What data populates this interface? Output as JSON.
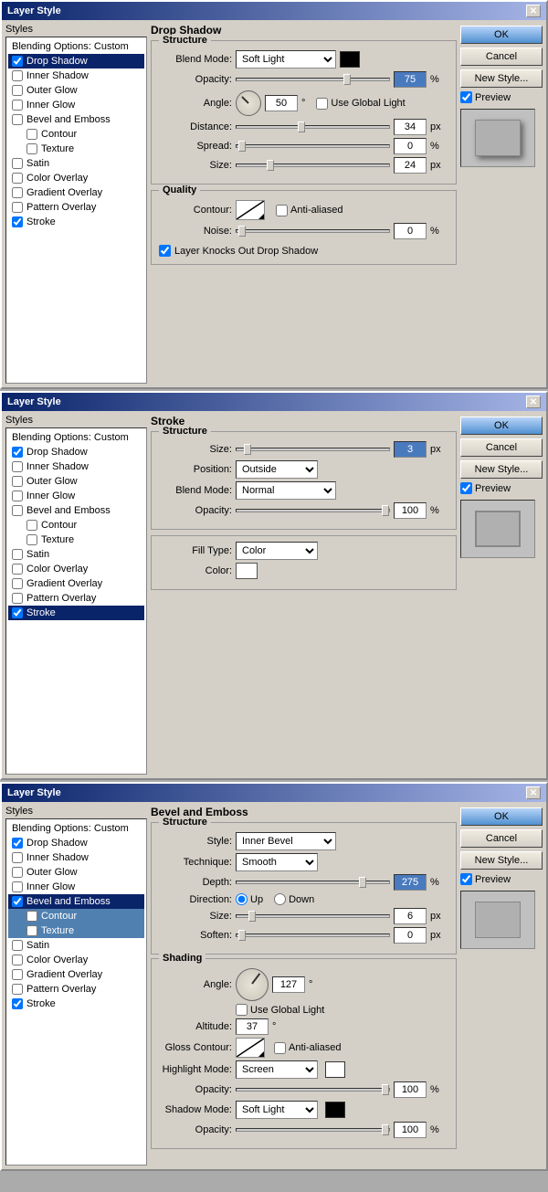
{
  "dialog1": {
    "title": "Layer Style",
    "section": "Drop Shadow",
    "structure_label": "Structure",
    "blend_mode_label": "Blend Mode:",
    "blend_mode_value": "Soft Light",
    "opacity_label": "Opacity:",
    "opacity_value": "75",
    "opacity_unit": "%",
    "angle_label": "Angle:",
    "angle_value": "50",
    "angle_unit": "°",
    "global_light_label": "Use Global Light",
    "distance_label": "Distance:",
    "distance_value": "34",
    "distance_unit": "px",
    "spread_label": "Spread:",
    "spread_value": "0",
    "spread_unit": "%",
    "size_label": "Size:",
    "size_value": "24",
    "size_unit": "px",
    "quality_label": "Quality",
    "contour_label": "Contour:",
    "anti_alias_label": "Anti-aliased",
    "noise_label": "Noise:",
    "noise_value": "0",
    "noise_unit": "%",
    "knock_label": "Layer Knocks Out Drop Shadow",
    "ok_label": "OK",
    "cancel_label": "Cancel",
    "new_style_label": "New Style...",
    "preview_label": "Preview",
    "styles_heading": "Styles",
    "blending_options_label": "Blending Options: Custom",
    "styles_items": [
      {
        "label": "Drop Shadow",
        "checked": true,
        "active": true
      },
      {
        "label": "Inner Shadow",
        "checked": false,
        "active": false
      },
      {
        "label": "Outer Glow",
        "checked": false,
        "active": false
      },
      {
        "label": "Inner Glow",
        "checked": false,
        "active": false
      },
      {
        "label": "Bevel and Emboss",
        "checked": false,
        "active": false
      },
      {
        "label": "Contour",
        "checked": false,
        "active": false,
        "sub": true
      },
      {
        "label": "Texture",
        "checked": false,
        "active": false,
        "sub": true
      },
      {
        "label": "Satin",
        "checked": false,
        "active": false
      },
      {
        "label": "Color Overlay",
        "checked": false,
        "active": false
      },
      {
        "label": "Gradient Overlay",
        "checked": false,
        "active": false
      },
      {
        "label": "Pattern Overlay",
        "checked": false,
        "active": false
      },
      {
        "label": "Stroke",
        "checked": true,
        "active": false
      }
    ]
  },
  "dialog2": {
    "title": "Layer Style",
    "section": "Stroke",
    "structure_label": "Structure",
    "size_label": "Size:",
    "size_value": "3",
    "size_unit": "px",
    "position_label": "Position:",
    "position_value": "Outside",
    "blend_mode_label": "Blend Mode:",
    "blend_mode_value": "Normal",
    "opacity_label": "Opacity:",
    "opacity_value": "100",
    "opacity_unit": "%",
    "fill_type_label": "Fill Type:",
    "fill_type_value": "Color",
    "color_label": "Color:",
    "ok_label": "OK",
    "cancel_label": "Cancel",
    "new_style_label": "New Style...",
    "preview_label": "Preview",
    "styles_heading": "Styles",
    "blending_options_label": "Blending Options: Custom",
    "styles_items": [
      {
        "label": "Drop Shadow",
        "checked": true,
        "active": false
      },
      {
        "label": "Inner Shadow",
        "checked": false,
        "active": false
      },
      {
        "label": "Outer Glow",
        "checked": false,
        "active": false
      },
      {
        "label": "Inner Glow",
        "checked": false,
        "active": false
      },
      {
        "label": "Bevel and Emboss",
        "checked": false,
        "active": false
      },
      {
        "label": "Contour",
        "checked": false,
        "active": false,
        "sub": true
      },
      {
        "label": "Texture",
        "checked": false,
        "active": false,
        "sub": true
      },
      {
        "label": "Satin",
        "checked": false,
        "active": false
      },
      {
        "label": "Color Overlay",
        "checked": false,
        "active": false
      },
      {
        "label": "Gradient Overlay",
        "checked": false,
        "active": false
      },
      {
        "label": "Pattern Overlay",
        "checked": false,
        "active": false
      },
      {
        "label": "Stroke",
        "checked": true,
        "active": true
      }
    ]
  },
  "dialog3": {
    "title": "Layer Style",
    "section": "Bevel and Emboss",
    "structure_label": "Structure",
    "style_label": "Style:",
    "style_value": "Inner Bevel",
    "technique_label": "Technique:",
    "technique_value": "Smooth",
    "depth_label": "Depth:",
    "depth_value": "275",
    "depth_unit": "%",
    "direction_label": "Direction:",
    "direction_up": "Up",
    "direction_down": "Down",
    "size_label": "Size:",
    "size_value": "6",
    "size_unit": "px",
    "soften_label": "Soften:",
    "soften_value": "0",
    "soften_unit": "px",
    "shading_label": "Shading",
    "angle_label": "Angle:",
    "angle_value": "127",
    "angle_unit": "°",
    "global_light_label": "Use Global Light",
    "altitude_label": "Altitude:",
    "altitude_value": "37",
    "altitude_unit": "°",
    "gloss_contour_label": "Gloss Contour:",
    "anti_alias_label": "Anti-aliased",
    "highlight_mode_label": "Highlight Mode:",
    "highlight_mode_value": "Screen",
    "highlight_opacity_label": "Opacity:",
    "highlight_opacity_value": "100",
    "highlight_opacity_unit": "%",
    "shadow_mode_label": "Shadow Mode:",
    "shadow_mode_value": "Soft Light",
    "shadow_opacity_label": "Opacity:",
    "shadow_opacity_value": "100",
    "shadow_opacity_unit": "%",
    "ok_label": "OK",
    "cancel_label": "Cancel",
    "new_style_label": "New Style...",
    "preview_label": "Preview",
    "styles_heading": "Styles",
    "blending_options_label": "Blending Options: Custom",
    "styles_items": [
      {
        "label": "Drop Shadow",
        "checked": true,
        "active": false
      },
      {
        "label": "Inner Shadow",
        "checked": false,
        "active": false
      },
      {
        "label": "Outer Glow",
        "checked": false,
        "active": false
      },
      {
        "label": "Inner Glow",
        "checked": false,
        "active": false
      },
      {
        "label": "Bevel and Emboss",
        "checked": true,
        "active": true
      },
      {
        "label": "Contour",
        "checked": false,
        "active": false,
        "sub": true,
        "highlighted": true
      },
      {
        "label": "Texture",
        "checked": false,
        "active": false,
        "sub": true,
        "highlighted": true
      },
      {
        "label": "Satin",
        "checked": false,
        "active": false
      },
      {
        "label": "Color Overlay",
        "checked": false,
        "active": false
      },
      {
        "label": "Gradient Overlay",
        "checked": false,
        "active": false
      },
      {
        "label": "Pattern Overlay",
        "checked": false,
        "active": false
      },
      {
        "label": "Stroke",
        "checked": true,
        "active": false
      }
    ]
  }
}
